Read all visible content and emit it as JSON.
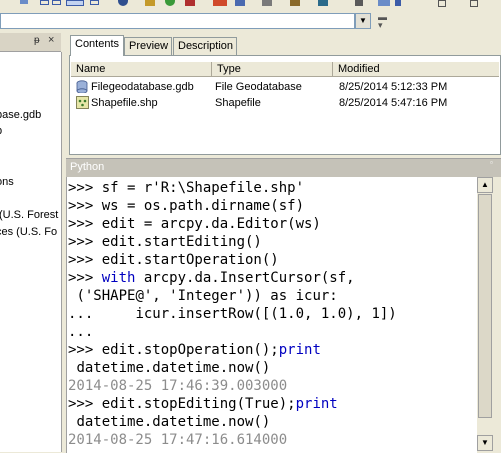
{
  "catalog": {
    "pin_glyph": "ᵽ",
    "close_glyph": "×",
    "tree_items": [
      {
        "label": "base.gdb"
      },
      {
        "label": "p"
      },
      {
        "label": "ons"
      },
      {
        "label": "(U.S. Forest"
      },
      {
        "label": "ces (U.S. Fo"
      }
    ]
  },
  "tabs": [
    {
      "label": "Contents"
    },
    {
      "label": "Preview"
    },
    {
      "label": "Description"
    }
  ],
  "contents": {
    "columns": [
      "Name",
      "Type",
      "Modified"
    ],
    "rows": [
      {
        "name": "Filegeodatabase.gdb",
        "type": "File Geodatabase",
        "modified": "8/25/2014 5:12:33 PM",
        "icon": "geodatabase-icon"
      },
      {
        "name": "Shapefile.shp",
        "type": "Shapefile",
        "modified": "8/25/2014 5:47:16 PM",
        "icon": "shapefile-icon"
      }
    ]
  },
  "python": {
    "title": "Python",
    "lines": [
      {
        "prompt": ">>> ",
        "code": "sf = r'R:\\Shapefile.shp'"
      },
      {
        "prompt": ">>> ",
        "code": "ws = os.path.dirname(sf)"
      },
      {
        "prompt": ">>> ",
        "code": "edit = arcpy.da.Editor(ws)"
      },
      {
        "prompt": ">>> ",
        "code": "edit.startEditing()"
      },
      {
        "prompt": ">>> ",
        "code": "edit.startOperation()"
      },
      {
        "prompt": ">>> ",
        "kw": "with",
        "code": " arcpy.da.InsertCursor(sf,"
      },
      {
        "prompt": " ",
        "code": "('SHAPE@', 'Integer')) as icur:"
      },
      {
        "prompt": "...     ",
        "code": "icur.insertRow([(1.0, 1.0), 1])"
      },
      {
        "prompt": "...",
        "code": ""
      },
      {
        "prompt": ">>> ",
        "code": "edit.stopOperation();",
        "kw2": "print"
      },
      {
        "prompt": " ",
        "code": "datetime.datetime.now()"
      },
      {
        "output": "2014-08-25 17:46:39.003000"
      },
      {
        "prompt": ">>> ",
        "code": "edit.stopEditing(True);",
        "kw2": "print"
      },
      {
        "prompt": " ",
        "code": "datetime.datetime.now()"
      },
      {
        "output": "2014-08-25 17:47:16.614000"
      }
    ]
  }
}
